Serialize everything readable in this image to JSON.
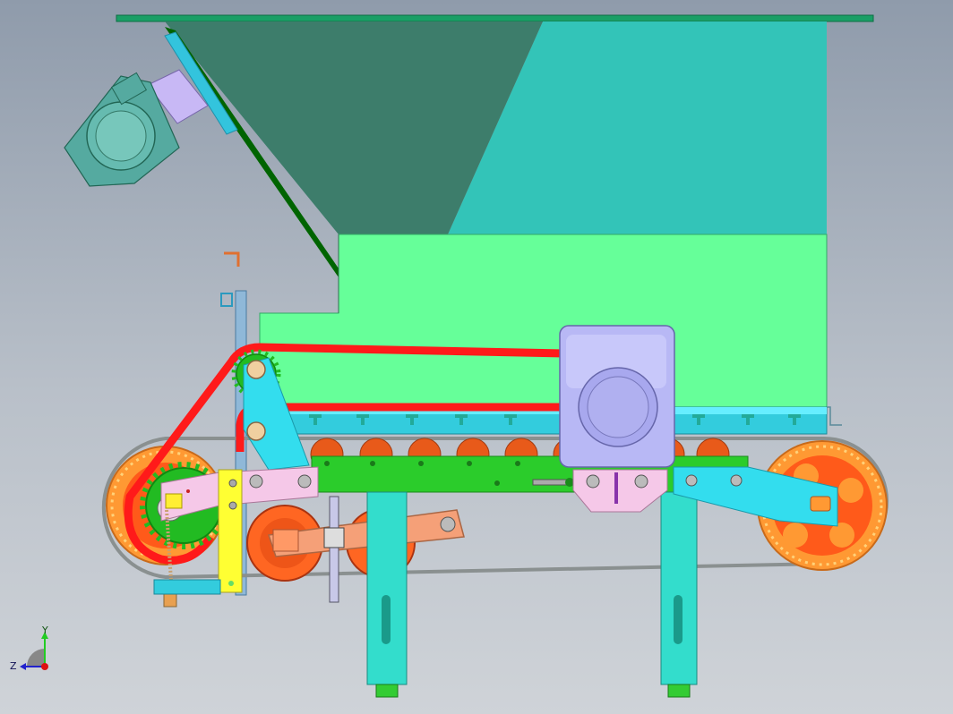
{
  "scene": {
    "name": "feeder-hopper-with-conveyor-cad-view",
    "colors": {
      "background_top": "#8f9bab",
      "background_bottom": "#cfd3d8",
      "hopper_dark": "#3d7d6b",
      "hopper_teal": "#33c4b8",
      "hopper_body": "#66ff99",
      "hopper_lid": "#1a9f66",
      "chute_dark_green": "#006400",
      "chain_red": "#ff1a1a",
      "sprocket_orange": "#ff9933",
      "sprocket_inner": "#ff5a1a",
      "roller_orange": "#e85a1a",
      "conveyor_frame": "#2bcc2b",
      "cyan_part": "#33ccdd",
      "cyan_light": "#66eeff",
      "pink_part": "#f5c8e8",
      "lavender_motor": "#b8b8f5",
      "yellow_plate": "#ffff33",
      "salmon_arm": "#f5a078",
      "leg_cyan": "#33ddcc",
      "foot_green": "#33cc33",
      "track_gray": "#8a9090"
    }
  },
  "triad": {
    "y_label": "Y",
    "z_label": "Z",
    "y_color": "#22cc22",
    "z_color": "#2222cc",
    "origin_color": "#dd1111"
  }
}
